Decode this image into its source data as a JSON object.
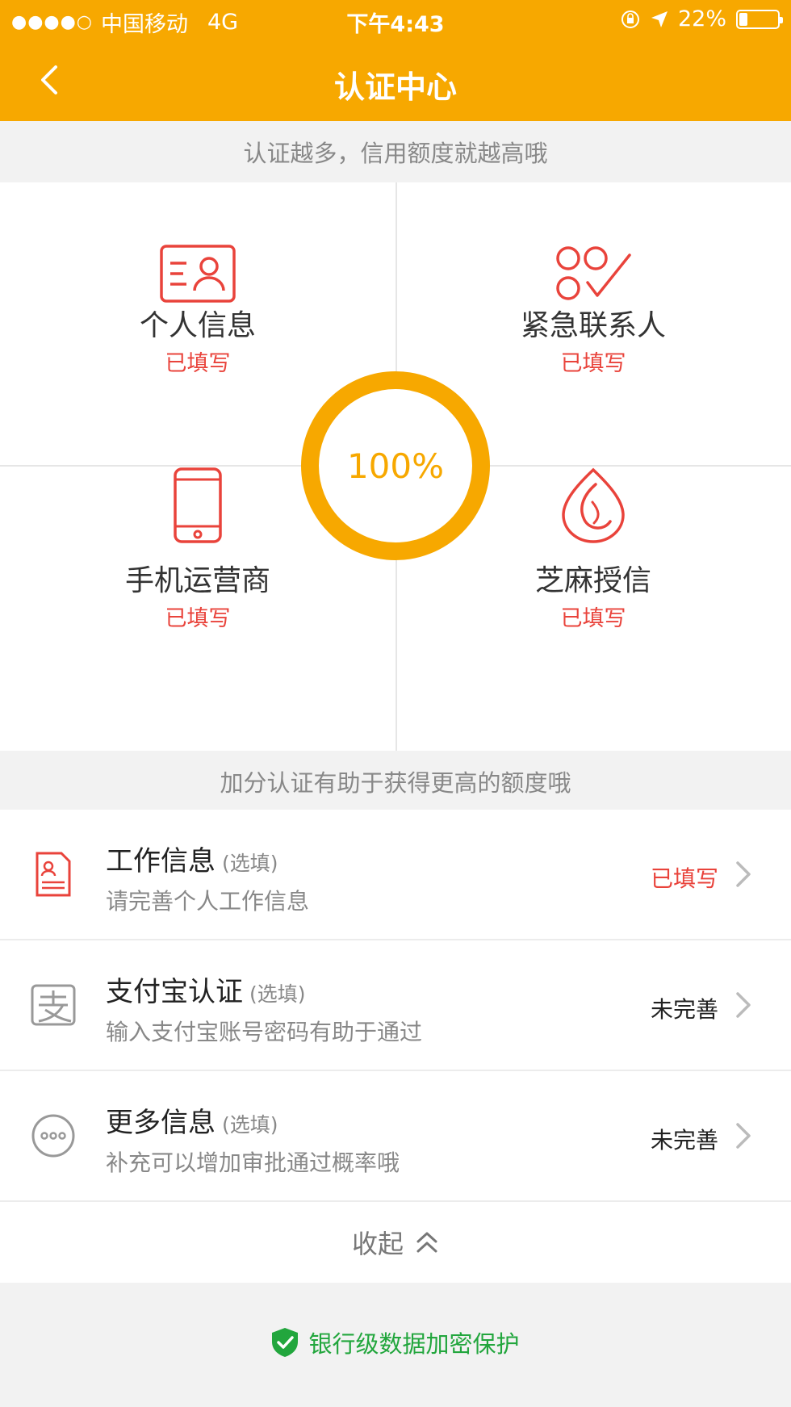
{
  "status_bar": {
    "signal": "●●●●○",
    "carrier": "中国移动",
    "network": "4G",
    "time": "下午4:43",
    "battery": "22%"
  },
  "nav": {
    "title": "认证中心"
  },
  "tips": {
    "top": "认证越多，信用额度就越高哦",
    "bonus": "加分认证有助于获得更高的额度哦"
  },
  "grid": {
    "progress": "100%",
    "items": [
      {
        "label": "个人信息",
        "status": "已填写",
        "icon": "id-card-icon"
      },
      {
        "label": "紧急联系人",
        "status": "已填写",
        "icon": "contacts-check-icon"
      },
      {
        "label": "手机运营商",
        "status": "已填写",
        "icon": "phone-icon"
      },
      {
        "label": "芝麻授信",
        "status": "已填写",
        "icon": "sesame-icon"
      }
    ]
  },
  "list": {
    "items": [
      {
        "title": "工作信息",
        "optional": "(选填)",
        "subtitle": "请完善个人工作信息",
        "status": "已填写",
        "status_color": "#e9433b",
        "icon": "document-icon"
      },
      {
        "title": "支付宝认证",
        "optional": "(选填)",
        "subtitle": "输入支付宝账号密码有助于通过",
        "status": "未完善",
        "status_color": "#222222",
        "icon": "alipay-icon"
      },
      {
        "title": "更多信息",
        "optional": "(选填)",
        "subtitle": "补充可以增加审批通过概率哦",
        "status": "未完善",
        "status_color": "#222222",
        "icon": "more-icon"
      }
    ],
    "collapse_label": "收起"
  },
  "footer": {
    "secure_text": "银行级数据加密保护"
  },
  "colors": {
    "brand": "#f7a800",
    "done": "#e9433b",
    "secure": "#22a63d"
  }
}
